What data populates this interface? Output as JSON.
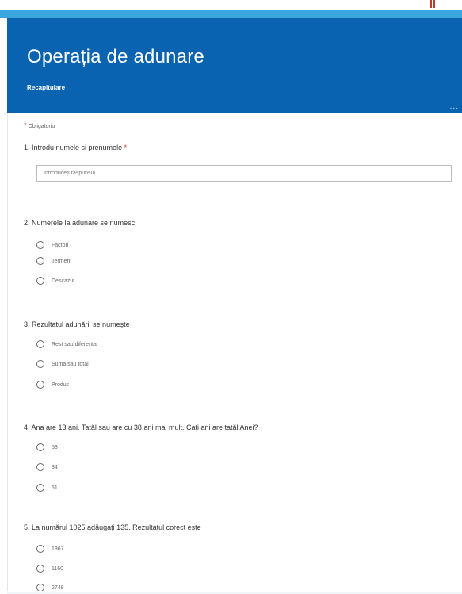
{
  "form": {
    "title": "Operația de adunare",
    "subtitle": "Recapitulare",
    "more": "...",
    "required_note": "Obligatoriu",
    "colors": {
      "header": "#0a63b0",
      "strip": "#3aa6dd",
      "required": "#dd3333"
    }
  },
  "questions": [
    {
      "label": "1. Introdu numele si prenumele",
      "required": "*",
      "input_placeholder": "Introduceți răspunsul"
    },
    {
      "label": "2. Numerele la adunare se numesc",
      "options": [
        "Factori",
        "Termeni",
        "Descazut"
      ]
    },
    {
      "label": "3. Rezultatul adunării se numeşte",
      "options": [
        "Rest sau diferenta",
        "Suma sau total",
        "Produs"
      ]
    },
    {
      "label": "4. Ana are 13 ani. Tatăl sau are cu 38 ani mai mult. Cați ani are tatăl Anei?",
      "options": [
        "53",
        "34",
        "51"
      ]
    },
    {
      "label": "5. La numărul 1025 adăugați 135. Rezultatul corect este",
      "options": [
        "1367",
        "1160",
        "2748"
      ]
    }
  ]
}
